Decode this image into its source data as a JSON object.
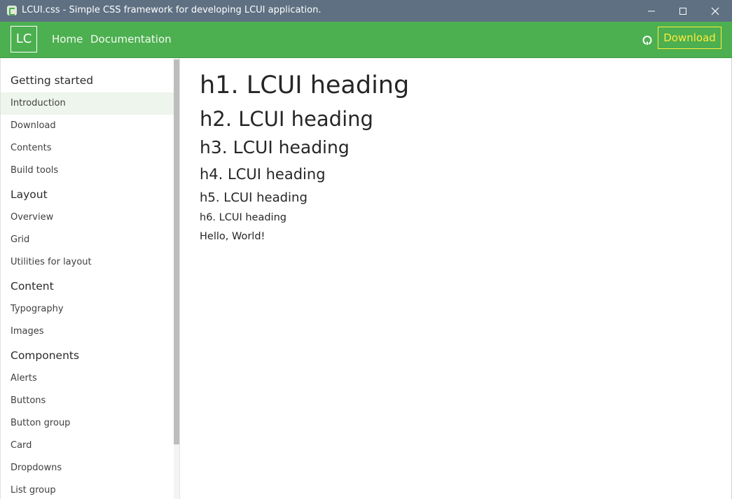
{
  "window": {
    "title": "LCUI.css - Simple CSS framework for developing LCUI application.",
    "controls": [
      "minimize",
      "maximize",
      "close"
    ],
    "titlebar_color": "#5e7082"
  },
  "navbar": {
    "brand": "LC",
    "links": [
      "Home",
      "Documentation"
    ],
    "github_icon": "github-icon",
    "download_label": "Download",
    "background_color": "#4caf50",
    "download_color": "#ffeb3b"
  },
  "sidebar": {
    "sections": [
      {
        "heading": "Getting started",
        "items": [
          "Introduction",
          "Download",
          "Contents",
          "Build tools"
        ]
      },
      {
        "heading": "Layout",
        "items": [
          "Overview",
          "Grid",
          "Utilities for layout"
        ]
      },
      {
        "heading": "Content",
        "items": [
          "Typography",
          "Images"
        ]
      },
      {
        "heading": "Components",
        "items": [
          "Alerts",
          "Buttons",
          "Button group",
          "Card",
          "Dropdowns",
          "List group"
        ]
      }
    ],
    "active_item": "Introduction"
  },
  "content": {
    "h1": "h1. LCUI heading",
    "h2": "h2. LCUI heading",
    "h3": "h3. LCUI heading",
    "h4": "h4. LCUI heading",
    "h5": "h5. LCUI heading",
    "h6": "h6. LCUI heading",
    "paragraph": "Hello, World!"
  }
}
